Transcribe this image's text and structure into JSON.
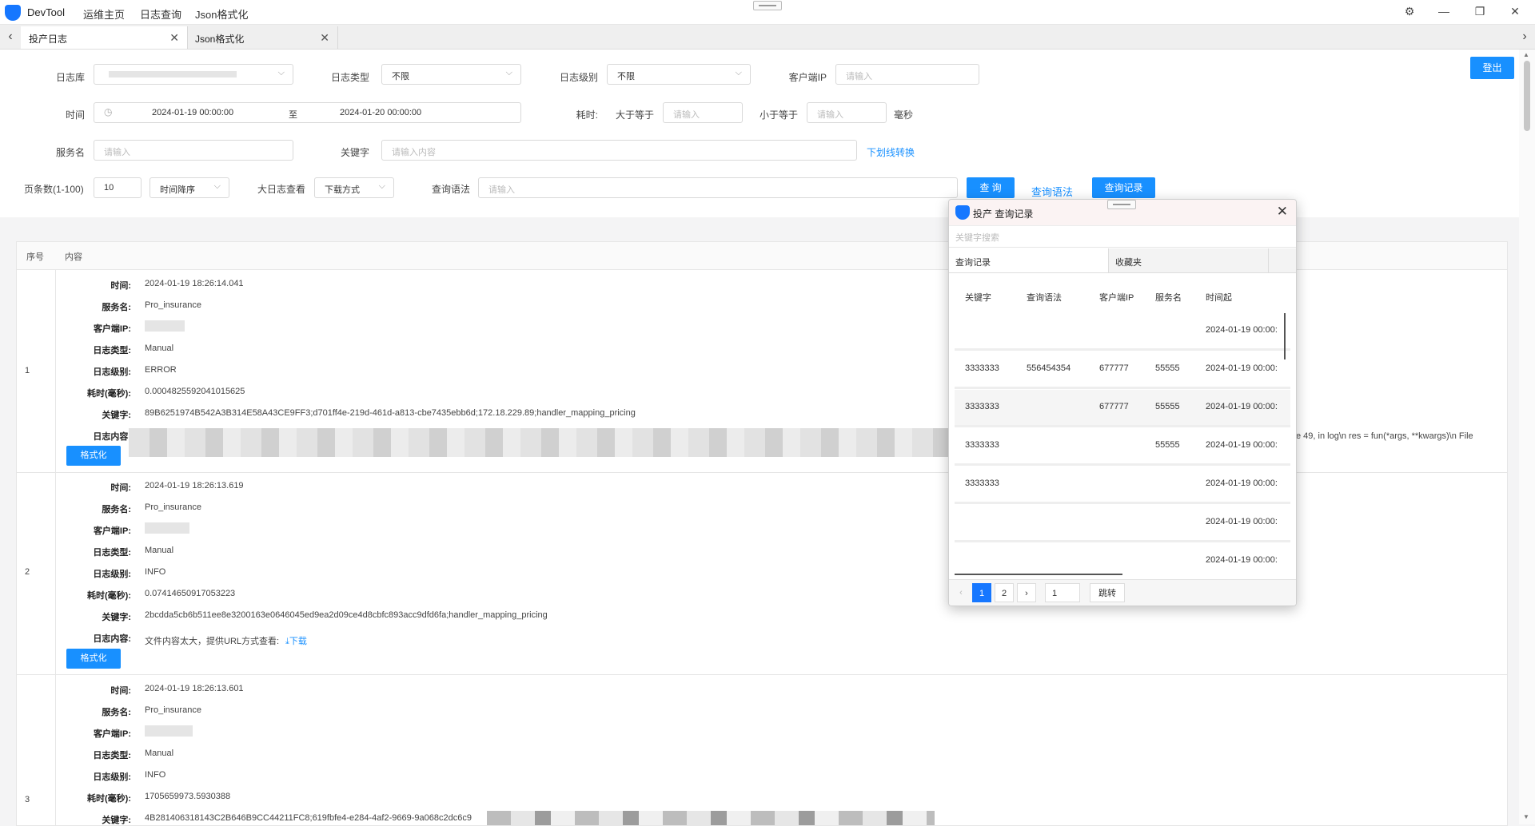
{
  "titlebar": {
    "app_name": "DevTool",
    "menus": [
      "运维主页",
      "日志查询",
      "Json格式化"
    ],
    "icons": [
      "settings-icon",
      "minimize-icon",
      "maximize-icon",
      "close-icon"
    ]
  },
  "tabs": [
    {
      "label": "投产日志",
      "active": true
    },
    {
      "label": "Json格式化",
      "active": false
    }
  ],
  "filters": {
    "log_db_label": "日志库",
    "log_type_label": "日志类型",
    "log_type_value": "不限",
    "log_level_label": "日志级别",
    "log_level_value": "不限",
    "client_ip_label": "客户端IP",
    "placeholder_input": "请输入",
    "logout": "登出",
    "time_label": "时间",
    "time_start": "2024-01-19 00:00:00",
    "time_to": "至",
    "time_end": "2024-01-20 00:00:00",
    "cost_label": "耗时:",
    "gte_label": "大于等于",
    "lte_label": "小于等于",
    "ms_unit": "毫秒",
    "service_label": "服务名",
    "keyword_label": "关键字",
    "keyword_placeholder": "请输入内容",
    "underscore_convert": "下划线转换",
    "page_size_label": "页条数(1-100)",
    "page_size_value": "10",
    "sort_value": "时间降序",
    "big_log_label": "大日志查看",
    "download_mode": "下载方式",
    "query_syntax_label": "查询语法",
    "query_btn": "查 询",
    "query_syntax_link": "查询语法",
    "query_history_btn": "查询记录"
  },
  "table": {
    "col_seq": "序号",
    "col_content": "内容",
    "field_labels": {
      "time": "时间:",
      "service": "服务名:",
      "client_ip": "客户端IP:",
      "log_type": "日志类型:",
      "log_level": "日志级别:",
      "cost": "耗时(毫秒):",
      "keyword": "关键字:",
      "content": "日志内容:"
    },
    "format_btn": "格式化",
    "rows": [
      {
        "seq": "1",
        "time": "2024-01-19 18:26:14.041",
        "service": "Pro_insurance",
        "log_type": "Manual",
        "log_level": "ERROR",
        "cost": "0.0004825592041015625",
        "keyword": "89B6251974B542A3B314E58A43CE9FF3;d701ff4e-219d-461d-a813-cbe7435ebb6d;172.18.229.89;handler_mapping_pricing",
        "content_tail": "e 49, in log\\n res = fun(*args, **kwargs)\\n File"
      },
      {
        "seq": "2",
        "time": "2024-01-19 18:26:13.619",
        "service": "Pro_insurance",
        "log_type": "Manual",
        "log_level": "INFO",
        "cost": "0.07414650917053223",
        "keyword": "2bcdda5cb6b511ee8e3200163e0646045ed9ea2d09ce4d8cbfc893acc9dfd6fa;handler_mapping_pricing",
        "content": "文件内容太大，提供URL方式查看:",
        "download": "⤓下载"
      },
      {
        "seq": "3",
        "time": "2024-01-19 18:26:13.601",
        "service": "Pro_insurance",
        "log_type": "Manual",
        "log_level": "INFO",
        "cost": "1705659973.5930388",
        "keyword": "4B281406318143C2B646B9CC44211FC8;619fbfe4-e284-4af2-9669-9a068c2dc6c9"
      }
    ]
  },
  "popup": {
    "title": "投产 查询记录",
    "search_placeholder": "关键字搜索",
    "tabs": [
      "查询记录",
      "收藏夹"
    ],
    "columns": [
      "关键字",
      "查询语法",
      "客户端IP",
      "服务名",
      "时间起"
    ],
    "rows": [
      {
        "keyword": "",
        "syntax": "",
        "ip": "",
        "service": "",
        "time": "2024-01-19 00:00:"
      },
      {
        "keyword": "3333333",
        "syntax": "556454354",
        "ip": "677777",
        "service": "55555",
        "time": "2024-01-19 00:00:"
      },
      {
        "keyword": "3333333",
        "syntax": "",
        "ip": "677777",
        "service": "55555",
        "time": "2024-01-19 00:00:"
      },
      {
        "keyword": "3333333",
        "syntax": "",
        "ip": "",
        "service": "55555",
        "time": "2024-01-19 00:00:"
      },
      {
        "keyword": "3333333",
        "syntax": "",
        "ip": "",
        "service": "",
        "time": "2024-01-19 00:00:"
      },
      {
        "keyword": "",
        "syntax": "",
        "ip": "",
        "service": "",
        "time": "2024-01-19 00:00:"
      },
      {
        "keyword": "",
        "syntax": "",
        "ip": "",
        "service": "",
        "time": "2024-01-19 00:00:"
      }
    ],
    "pages": [
      "1",
      "2"
    ],
    "current_page": "1",
    "jump_input": "1",
    "jump_btn": "跳转"
  },
  "colors": {
    "accent": "#1890ff",
    "brand_icon": "#1677ff"
  }
}
